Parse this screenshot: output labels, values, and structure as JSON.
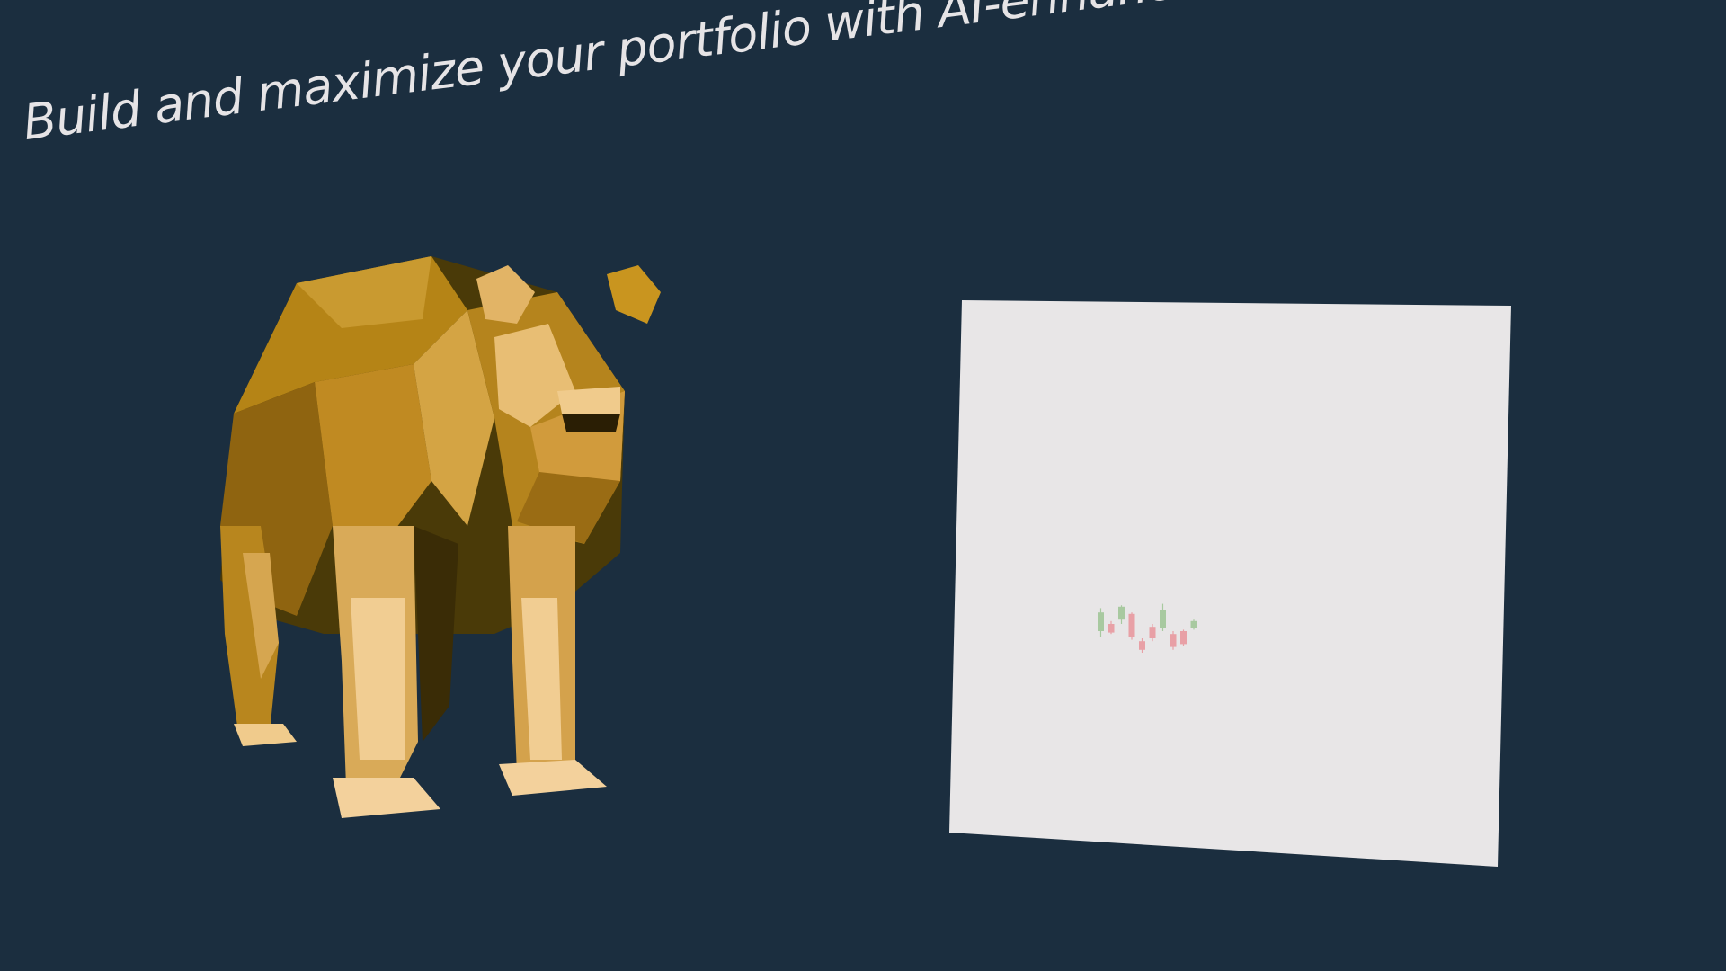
{
  "hero": {
    "headline": "Build and maximize your portfolio with AI-enhanced pattern"
  },
  "colors": {
    "background": "#1b2e3f",
    "headline_text": "#e6e4e6",
    "bear_gold": "#c08a22",
    "card": "#e8e6e7",
    "candle_up": "#a8c9a0",
    "candle_down": "#e8a0a6"
  },
  "icons": {
    "bear": "low-poly-bear-icon",
    "chart": "candlestick-chart-icon"
  },
  "chart_data": {
    "type": "candlestick",
    "title": "",
    "xlabel": "",
    "ylabel": "",
    "candles": [
      {
        "open": 0.45,
        "close": 0.58,
        "low": 0.41,
        "high": 0.61
      },
      {
        "open": 0.5,
        "close": 0.44,
        "low": 0.43,
        "high": 0.52
      },
      {
        "open": 0.53,
        "close": 0.62,
        "low": 0.5,
        "high": 0.63
      },
      {
        "open": 0.57,
        "close": 0.41,
        "low": 0.39,
        "high": 0.58
      },
      {
        "open": 0.38,
        "close": 0.32,
        "low": 0.3,
        "high": 0.4
      },
      {
        "open": 0.48,
        "close": 0.4,
        "low": 0.38,
        "high": 0.5
      },
      {
        "open": 0.47,
        "close": 0.6,
        "low": 0.45,
        "high": 0.64
      },
      {
        "open": 0.43,
        "close": 0.34,
        "low": 0.32,
        "high": 0.45
      },
      {
        "open": 0.45,
        "close": 0.36,
        "low": 0.35,
        "high": 0.46
      },
      {
        "open": 0.47,
        "close": 0.52,
        "low": 0.46,
        "high": 0.53
      }
    ]
  }
}
